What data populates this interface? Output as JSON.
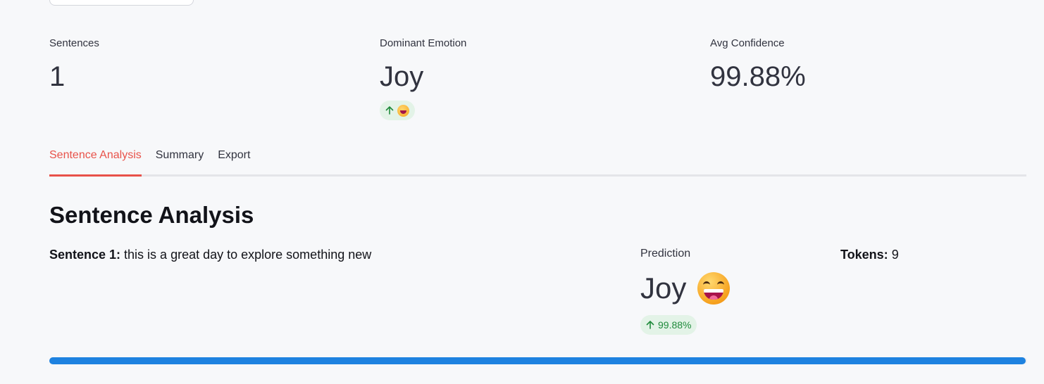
{
  "metrics": {
    "sentences": {
      "label": "Sentences",
      "value": "1"
    },
    "dominant_emotion": {
      "label": "Dominant Emotion",
      "value": "Joy",
      "delta_emoji": "😄"
    },
    "avg_confidence": {
      "label": "Avg Confidence",
      "value": "99.88%"
    }
  },
  "tabs": [
    {
      "label": "Sentence Analysis",
      "active": true
    },
    {
      "label": "Summary",
      "active": false
    },
    {
      "label": "Export",
      "active": false
    }
  ],
  "section_title": "Sentence Analysis",
  "sentence": {
    "label": "Sentence 1:",
    "text": " this is a great day to explore something new"
  },
  "prediction": {
    "label": "Prediction",
    "value": "Joy",
    "emoji": "grinning-face-with-big-eyes",
    "delta": "99.88%"
  },
  "tokens": {
    "label": "Tokens:",
    "value": " 9"
  },
  "confidence_progress": 0.9988,
  "colors": {
    "accent_tab": "#e8524a",
    "progress_fill": "#1e82e0",
    "delta_bg": "#e3f3e7",
    "delta_text": "#1f8a3b"
  }
}
